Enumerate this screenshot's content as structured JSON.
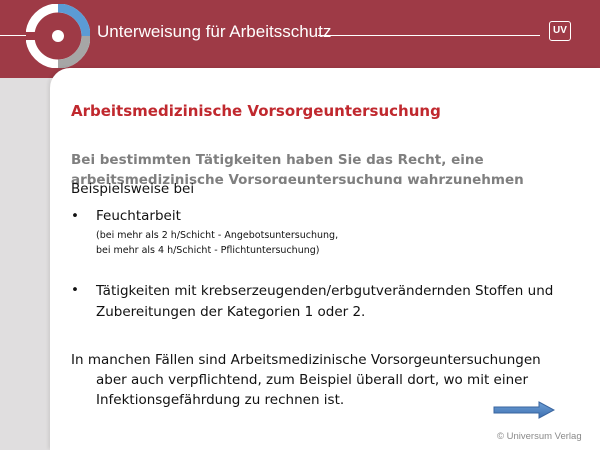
{
  "header": {
    "title": "Unterweisung für Arbeitsschutz",
    "badge": "UV",
    "color": "#9e3a46"
  },
  "slide": {
    "title": "Arbeitsmedizinische Vorsorgeuntersuchung",
    "subtitle": "Bei bestimmten Tätigkeiten haben Sie das Recht, eine arbeitsmedizinische Vorsorgeuntersuchung wahrzunehmen",
    "intro": "Beispielsweise bei",
    "bullet_symbol": "•",
    "bullets": [
      {
        "head": "Feuchtarbeit",
        "notes": [
          "(bei mehr als 2 h/Schicht - Angebotsuntersuchung,",
          "bei mehr als 4 h/Schicht - Pflichtuntersuchung)"
        ]
      },
      {
        "text": "Tätigkeiten mit krebserzeugenden/erbgutverändernden Stoffen und Zubereitungen der Kategorien 1 oder 2."
      }
    ],
    "paragraph_lines": [
      "In manchen Fällen sind Arbeitsmedizinische Vorsorgeuntersuchungen",
      "aber auch verpflichtend, zum Beispiel überall dort, wo mit einer",
      "Infektionsgefährdung zu rechnen ist."
    ],
    "title_color": "#c0282e",
    "next_icon": "arrow-right-icon"
  },
  "footer": {
    "copyright": "© Universum Verlag"
  }
}
